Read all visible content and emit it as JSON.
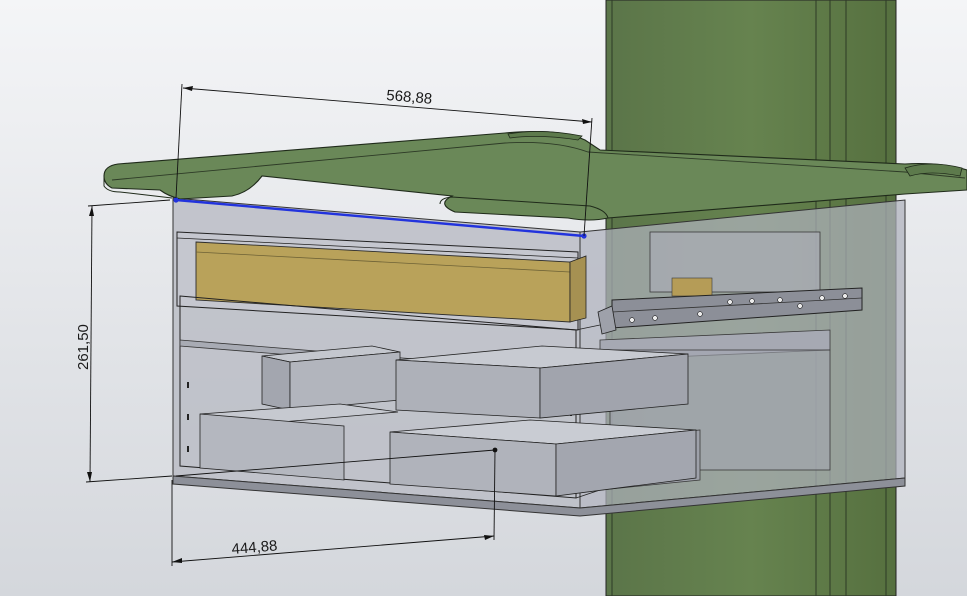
{
  "viewport": {
    "background_top": "#f4f5f7",
    "background_bottom": "#d4d7dc"
  },
  "model": {
    "pole_color": "#5f7a4e",
    "tabletop_color": "#6a8858",
    "box_fill": "#b7bac2",
    "drawer_color": "#b9a25a",
    "slide_color": "#8c8f98",
    "selected_edge_color": "#2233dd"
  },
  "dimensions": {
    "top_width": "568,88",
    "height": "261,50",
    "bottom_width": "444,88"
  }
}
